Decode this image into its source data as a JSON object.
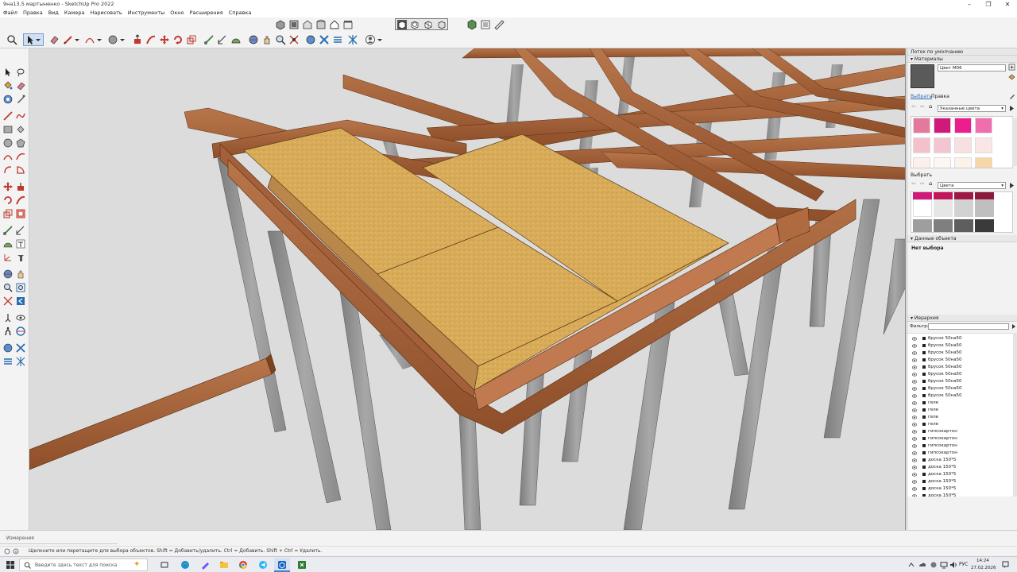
{
  "window": {
    "title": "9на13,5 мартыненко - SketchUp Pro 2022",
    "controls": {
      "minimize": "–",
      "maximize": "❐",
      "close": "✕"
    }
  },
  "menu": [
    "Файл",
    "Правка",
    "Вид",
    "Камера",
    "Нарисовать",
    "Инструменты",
    "Окно",
    "Расширения",
    "Справка"
  ],
  "tray": {
    "title": "Лоток по умолчанию",
    "materials": {
      "header": "Материалы",
      "material_name": "Цвет М06",
      "tabs": [
        "Выбрать",
        "Правка"
      ],
      "library": "Указанные цвета",
      "swatches": [
        "#e47a9b",
        "#d0197a",
        "#ec1d8d",
        "#ef6fae",
        "#f4c1cb",
        "#f2c6cf",
        "#f9e0e0",
        "#fae6e6",
        "#fdf0ec",
        "#fdf7f4",
        "#fbf2ea",
        "#f7d7a8"
      ]
    },
    "select2": {
      "header": "Выбрать",
      "library": "Цвета",
      "swatches": [
        "#d0197a",
        "#c2185b",
        "#9c1a45",
        "#8b1a3b",
        "#ffffff",
        "#e6e6e6",
        "#d2d2d2",
        "#bfbfbf",
        "#9e9e9e",
        "#7f7f7f",
        "#5e5e5e",
        "#3a3a3a"
      ]
    },
    "entity": {
      "header": "Данные объекта",
      "value": "Нет выбора"
    },
    "outliner": {
      "header": "Иерархия",
      "filter_label": "Фильтр:",
      "items": [
        "брусок 50на50",
        "брусок 50на50",
        "брусок 50на50",
        "брусок 50на50",
        "брусок 50на50",
        "брусок 50на50",
        "брусок 50на50",
        "брусок 50на50",
        "брусок 50на50",
        "гвле",
        "гвле",
        "гвле",
        "гвле",
        "гипсокартон",
        "гипсокартон",
        "гипсокартон",
        "гипсокартон",
        "доска 150*5",
        "доска 150*5",
        "доска 150*5",
        "доска 150*5",
        "доска 150*5",
        "доска 150*5"
      ]
    }
  },
  "measure": {
    "label": "Измерения"
  },
  "status": {
    "text": "Щелкните или перетащите для выбора объектов. Shift = Добавить/удалить. Ctrl = Добавить. Shift + Ctrl = Удалить."
  },
  "taskbar": {
    "search_placeholder": "Введите здесь текст для поиска",
    "lang": "РУС",
    "time": "14:24",
    "date": "27.02.2026"
  },
  "colors": {
    "beam": "#a9643a",
    "osb": "#d9ac5a",
    "post": "#8d8d8d",
    "accent_select": "#4c7fbf"
  }
}
